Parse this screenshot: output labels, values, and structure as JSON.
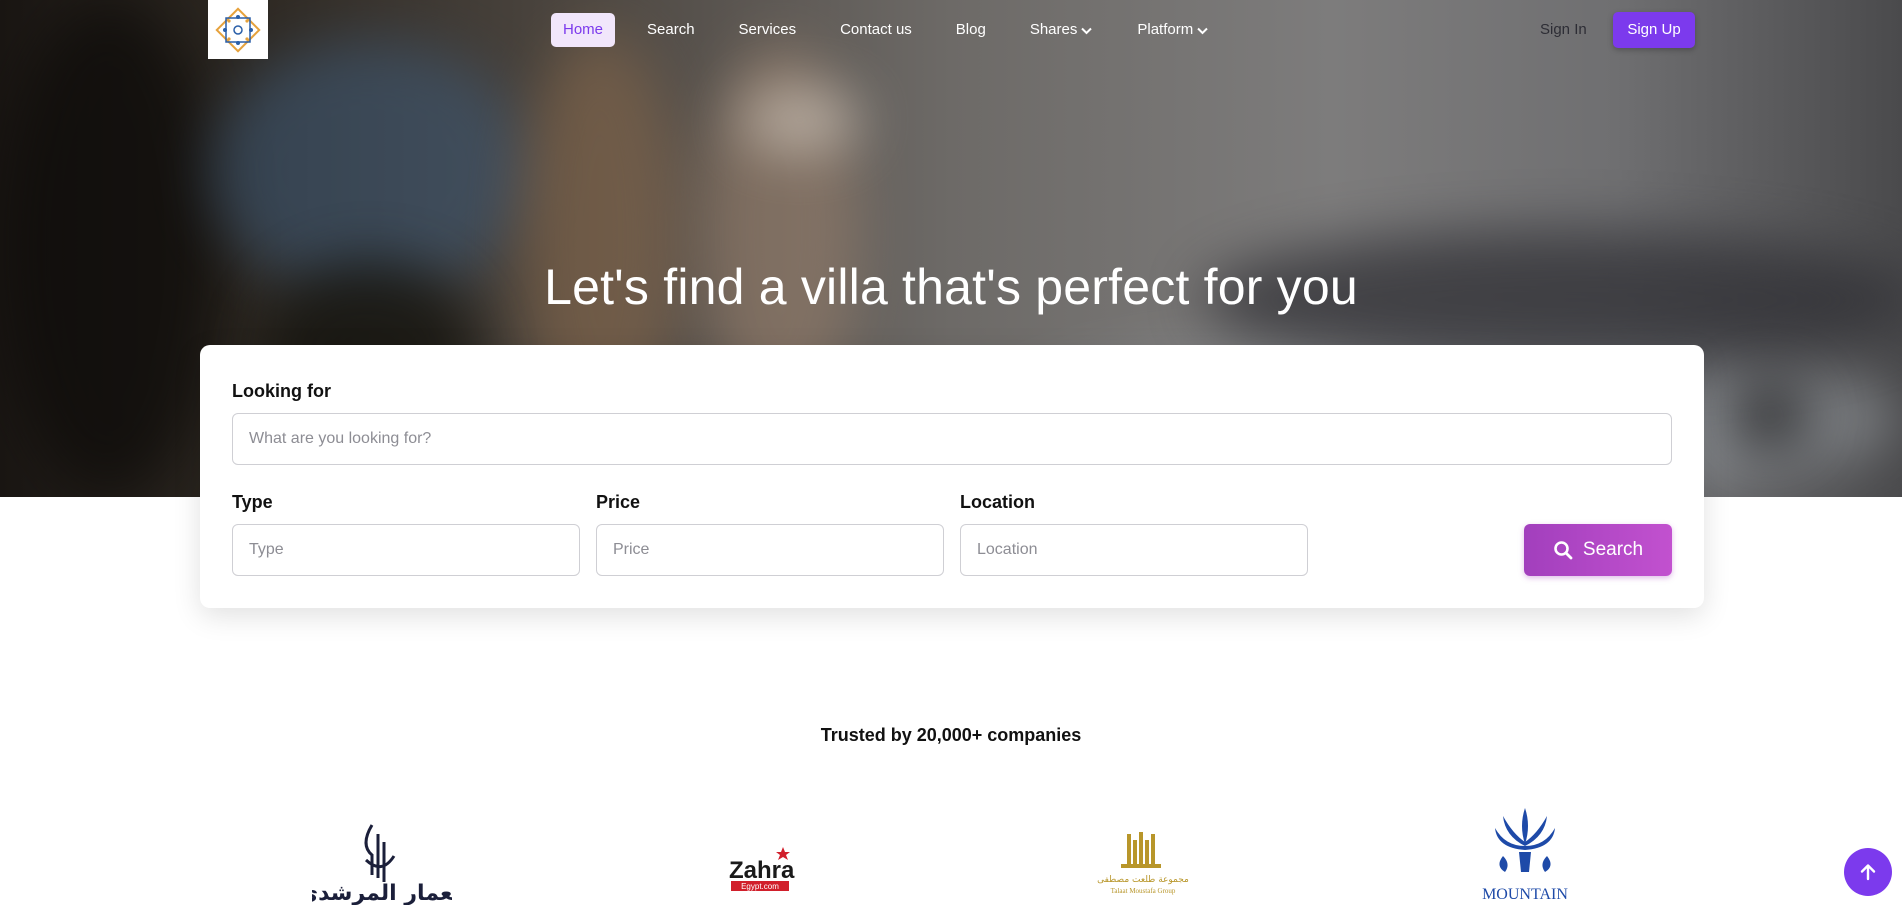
{
  "header": {
    "logo_icon": "brand-logo-icon",
    "nav": [
      {
        "label": "Home",
        "active": true
      },
      {
        "label": "Search"
      },
      {
        "label": "Services"
      },
      {
        "label": "Contact us"
      },
      {
        "label": "Blog"
      },
      {
        "label": "Shares",
        "has_dropdown": true
      },
      {
        "label": "Platform",
        "has_dropdown": true
      }
    ],
    "sign_in": "Sign In",
    "sign_up": "Sign Up"
  },
  "hero": {
    "title": "Let's find a villa that's perfect for you"
  },
  "search": {
    "looking_for_label": "Looking for",
    "looking_for_placeholder": "What are you looking for?",
    "type_label": "Type",
    "type_placeholder": "Type",
    "price_label": "Price",
    "price_placeholder": "Price",
    "location_label": "Location",
    "location_placeholder": "Location",
    "button_label": "Search",
    "button_icon": "search-icon"
  },
  "trusted": {
    "heading": "Trusted by 20,000+ companies",
    "partners": [
      {
        "name": "معمار المرشدى",
        "icon": "memar-almorshedy-logo"
      },
      {
        "name": "Zahra",
        "subtext": "Egypt.com",
        "icon": "zahra-logo"
      },
      {
        "name": "مجموعة طلعت مصطفى",
        "subtext": "Talaat Moustafa Group",
        "icon": "tmg-logo"
      },
      {
        "name": "MOUNTAIN",
        "icon": "mountain-logo"
      }
    ]
  },
  "scroll_top_icon": "arrow-up-icon",
  "colors": {
    "accent": "#7c3aed",
    "search_button": "#b448c6",
    "active_nav_bg": "#f1e6fb"
  }
}
